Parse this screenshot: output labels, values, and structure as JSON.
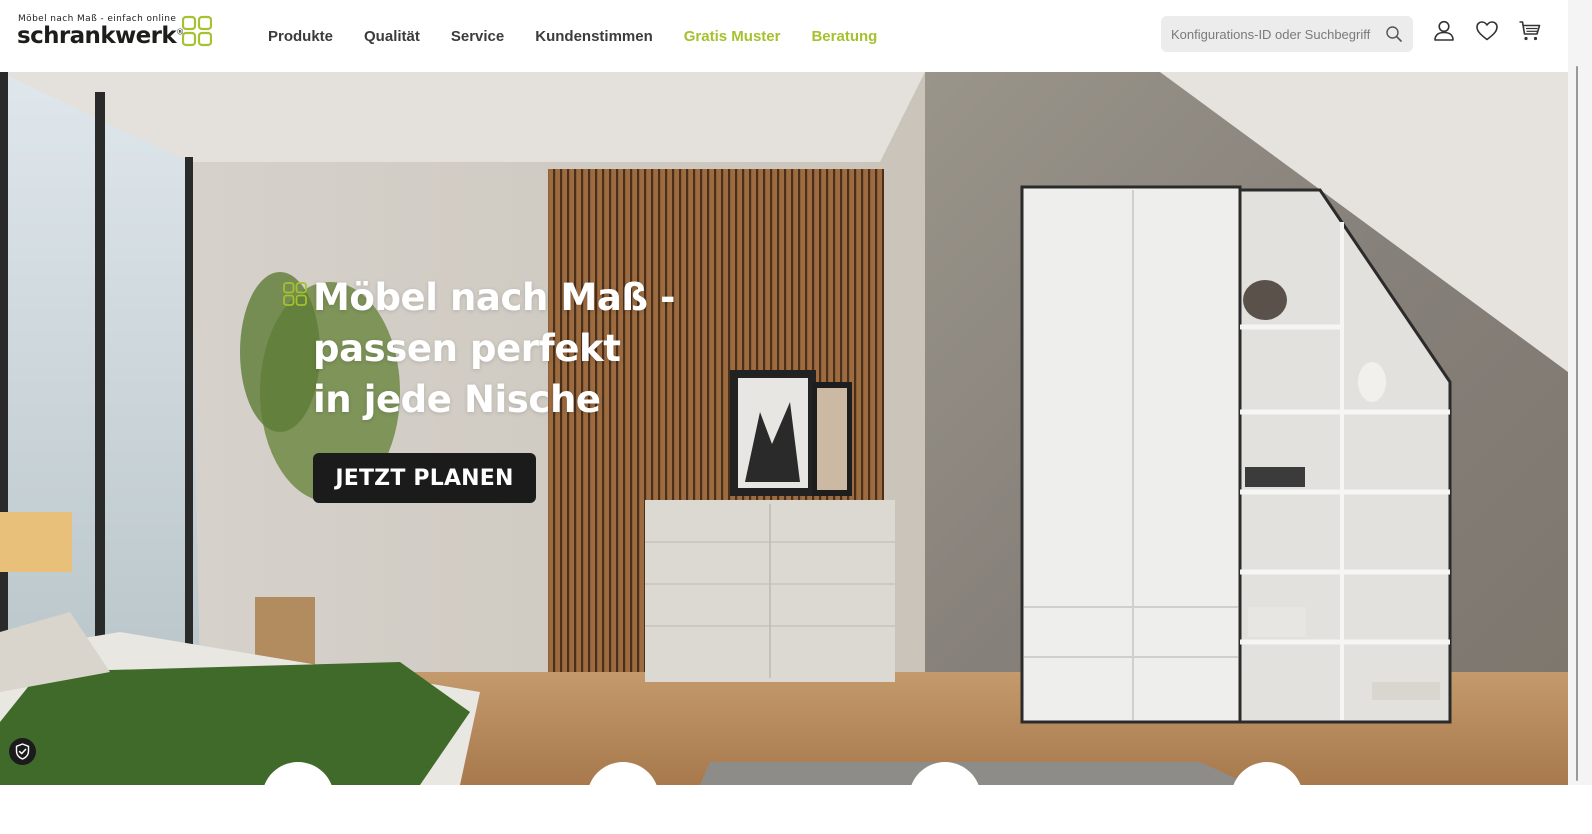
{
  "brand": {
    "tagline": "Möbel nach Maß - einfach online",
    "name": "schrankwerk",
    "registered": "®",
    "accent_color": "#a6c12f"
  },
  "nav": {
    "items": [
      {
        "label": "Produkte",
        "accent": false
      },
      {
        "label": "Qualität",
        "accent": false
      },
      {
        "label": "Service",
        "accent": false
      },
      {
        "label": "Kundenstimmen",
        "accent": false
      },
      {
        "label": "Gratis Muster",
        "accent": true
      },
      {
        "label": "Beratung",
        "accent": true
      }
    ]
  },
  "search": {
    "placeholder": "Konfigurations-ID oder Suchbegriff",
    "value": "",
    "icon": "search-icon"
  },
  "header_icons": [
    "account-icon",
    "wishlist-heart-icon",
    "cart-icon"
  ],
  "hero": {
    "headline_lines": [
      "Möbel nach Maß -",
      "passen perfekt",
      "in jede Nische"
    ],
    "cta_label": "JETZT PLANEN"
  },
  "cookie": {
    "icon": "cookie-settings-icon"
  }
}
